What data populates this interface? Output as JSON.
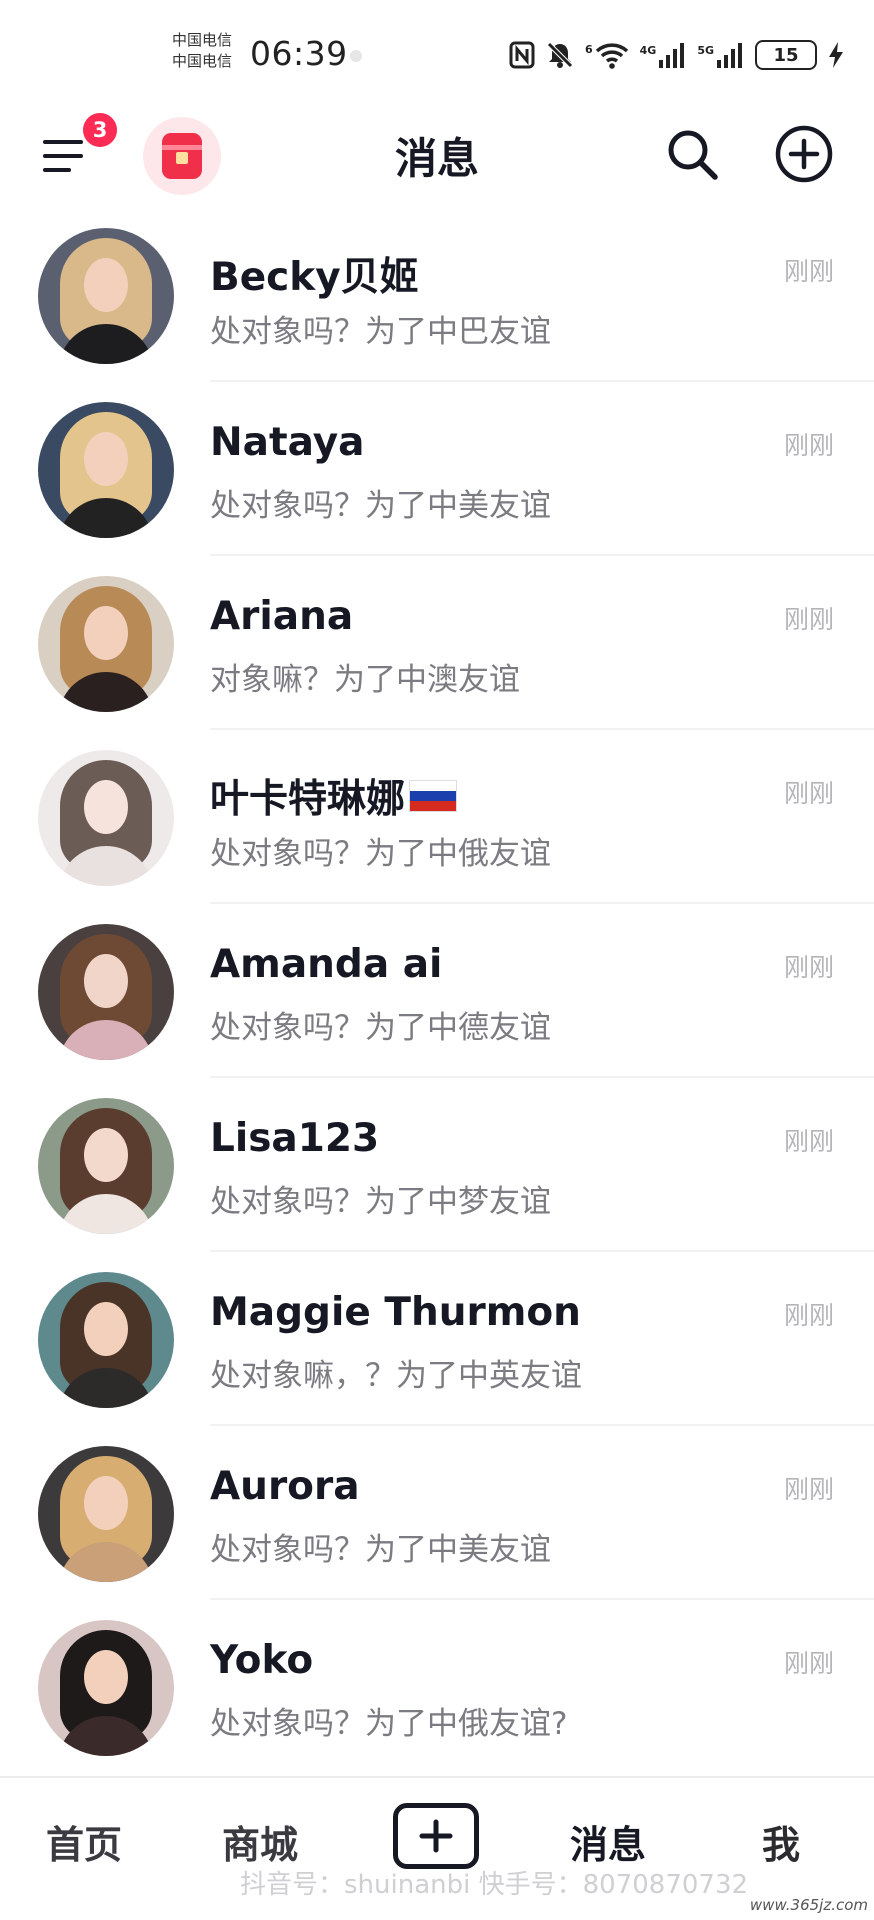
{
  "status_bar": {
    "carrier_1": "中国电信",
    "carrier_2": "中国电信",
    "time": "06:39",
    "wifi_label": "6",
    "signal_1_label": "4G",
    "signal_2_label": "5G",
    "battery": "15",
    "icons": [
      "nfc-icon",
      "mute-icon",
      "wifi-icon",
      "signal-4g-icon",
      "signal-5g-icon",
      "battery-icon",
      "charging-icon"
    ]
  },
  "header": {
    "title": "消息",
    "menu_badge": "3",
    "icons": [
      "menu-icon",
      "red-packet-icon",
      "search-icon",
      "add-circle-icon"
    ]
  },
  "conversations": [
    {
      "name": "Becky贝姬",
      "preview": "处对象吗？为了中巴友谊",
      "time": "刚刚"
    },
    {
      "name": "Nataya",
      "preview": "处对象吗？为了中美友谊",
      "time": "刚刚"
    },
    {
      "name": "Ariana",
      "preview": "对象嘛？为了中澳友谊",
      "time": "刚刚"
    },
    {
      "name": "叶卡特琳娜",
      "preview": "处对象吗？为了中俄友谊",
      "time": "刚刚",
      "flag": "russia-flag"
    },
    {
      "name": "Amanda ai",
      "preview": "处对象吗？为了中德友谊",
      "time": "刚刚"
    },
    {
      "name": "Lisa123",
      "preview": "处对象吗？为了中梦友谊",
      "time": "刚刚"
    },
    {
      "name": "Maggie Thurmon",
      "preview": "处对象嘛，？为了中英友谊",
      "time": "刚刚"
    },
    {
      "name": "Aurora",
      "preview": "处对象吗？为了中美友谊",
      "time": "刚刚"
    },
    {
      "name": "Yoko",
      "preview": "处对象吗？为了中俄友谊?",
      "time": "刚刚"
    }
  ],
  "bottom_nav": {
    "home": "首页",
    "mall": "商城",
    "messages": "消息",
    "me": "我",
    "add_icon": "plus-icon"
  },
  "watermark": "抖音号：shuinanbi 快手号：8070870732",
  "site_mark": "www.365jz.com",
  "colors": {
    "accent": "#fe2c55",
    "text_primary": "#161823",
    "text_secondary": "#7b7b82",
    "time_text": "#b4b4b9"
  }
}
